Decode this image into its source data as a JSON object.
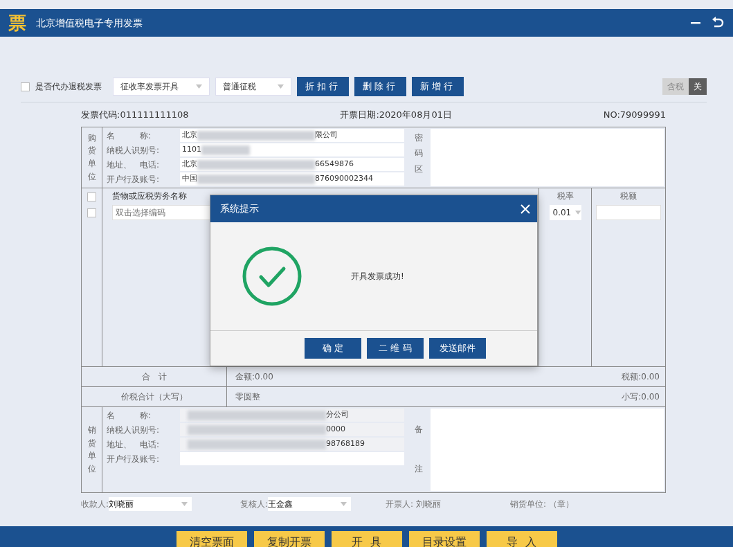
{
  "window": {
    "logo": "票",
    "title": "北京增值税电子专用发票"
  },
  "toolbar": {
    "refund_checkbox": {
      "label": "是否代办退税发票",
      "checked": false
    },
    "selects": [
      {
        "value": "征收率发票开具"
      },
      {
        "value": "普通征税"
      }
    ],
    "buttons": [
      "折扣行",
      "删除行",
      "新增行"
    ],
    "toggle": [
      {
        "label": "含税",
        "selected": false
      },
      {
        "label": "关",
        "selected": true
      }
    ]
  },
  "invoice": {
    "code": "发票代码:011111111108",
    "date": "开票日期:2020年08月01日",
    "number": "NO:79099991",
    "buyer": {
      "side_label": "购货单位",
      "fields": [
        {
          "label": "名　　　称:",
          "start": "北京",
          "end": "限公司",
          "redacted": true
        },
        {
          "label": "纳税人识别号:",
          "start": "1101",
          "redacted": true
        },
        {
          "label": "地址、　电话:",
          "start": "北京",
          "end": "66549876",
          "redacted": true
        },
        {
          "label": "开户行及账号:",
          "start": "中国",
          "end": "876090002344",
          "redacted": true
        }
      ],
      "side_right": "密码区"
    },
    "goods": {
      "rows": [
        {
          "checked": false
        },
        {
          "checked": false
        }
      ],
      "name_header": "货物或应税劳务名称",
      "name_placeholder": "双击选择编码",
      "rate_header": "税率",
      "rate_value": "0.01",
      "tax_header": "税额"
    },
    "total": {
      "label": "合　计",
      "amount": "金额:0.00",
      "tax": "税额:0.00"
    },
    "grand": {
      "label": "价税合计（大写）",
      "words": "零圆整",
      "small": "小写:0.00"
    },
    "seller": {
      "side_label": "销货单位",
      "fields": [
        {
          "label": "名　　　称:",
          "end": "分公司",
          "redacted": true
        },
        {
          "label": "纳税人识别号:",
          "end": "0000",
          "redacted": true
        },
        {
          "label": "地址、　电话:",
          "end": "98768189",
          "redacted": true
        },
        {
          "label": "开户行及账号:",
          "redacted": false
        }
      ],
      "side_right": "备注"
    },
    "footer": [
      {
        "label": "收款人:",
        "value": "刘晓丽",
        "kind": "select"
      },
      {
        "label": "复核人:",
        "value": "王金鑫",
        "kind": "select"
      },
      {
        "label": "开票人:",
        "value": "刘晓丽",
        "kind": "text"
      },
      {
        "label": "销货单位:",
        "value": "（章）",
        "kind": "text"
      }
    ]
  },
  "bottom_buttons": [
    "清空票面",
    "复制开票",
    "开  具",
    "目录设置",
    "导  入"
  ],
  "dialog": {
    "title": "系统提示",
    "message": "开具发票成功!",
    "buttons": [
      "确 定",
      "二 维 码",
      "发送邮件"
    ]
  }
}
